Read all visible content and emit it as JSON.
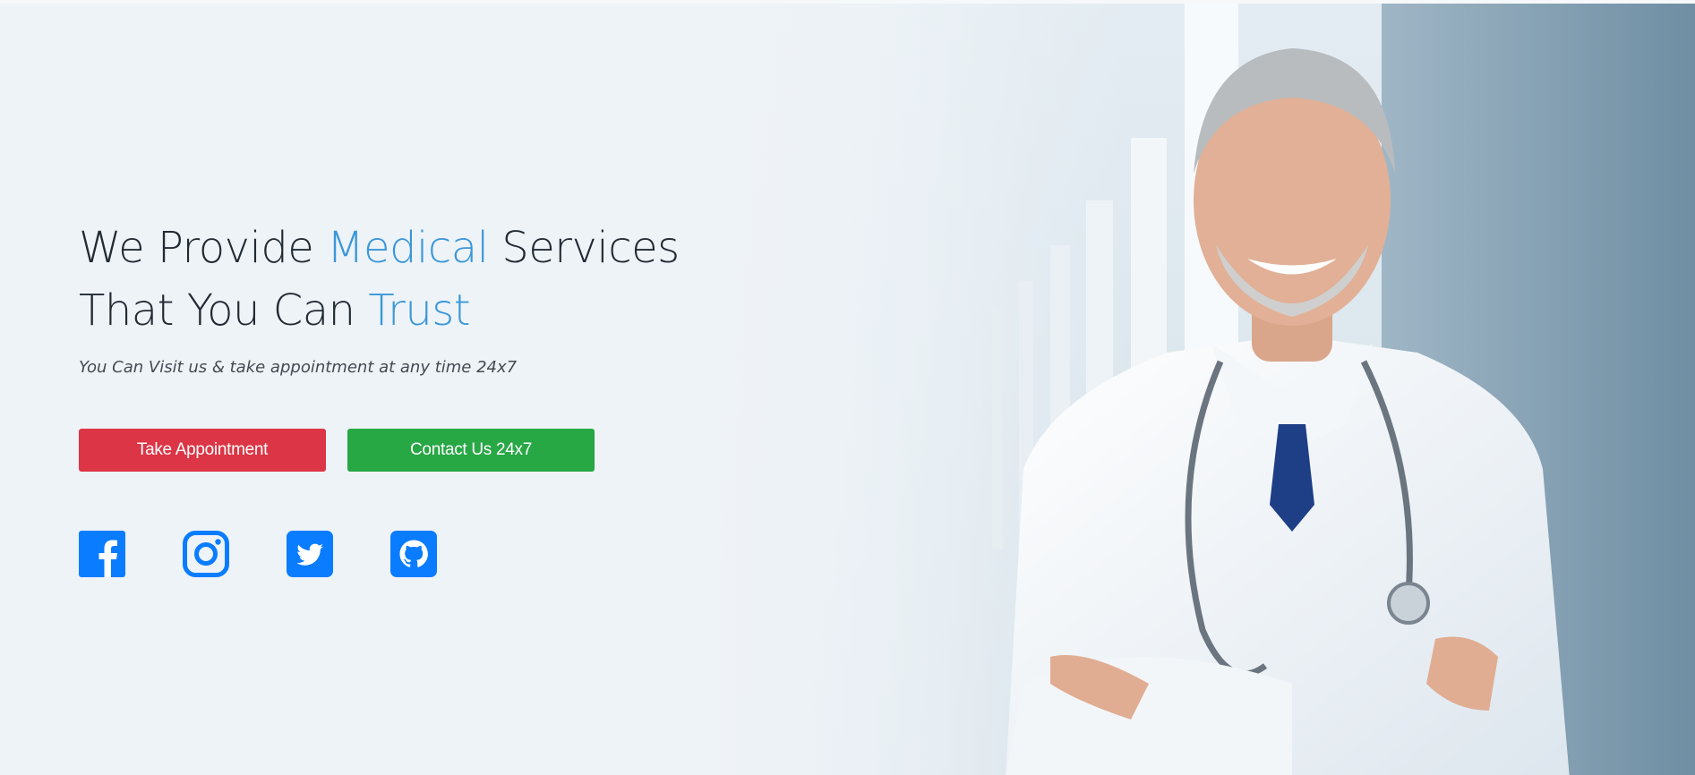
{
  "hero": {
    "headline": {
      "line1_prefix": "We Provide ",
      "line1_accent": "Medical",
      "line1_suffix": " Services",
      "line2_prefix": "That You Can ",
      "line2_accent": "Trust"
    },
    "subtitle": "You Can Visit us & take appointment at any time 24x7",
    "buttons": {
      "appointment": "Take Appointment",
      "contact": "Contact Us 24x7"
    },
    "social": [
      {
        "name": "facebook-icon"
      },
      {
        "name": "instagram-icon"
      },
      {
        "name": "twitter-icon"
      },
      {
        "name": "github-icon"
      }
    ]
  },
  "colors": {
    "accent": "#3b97d8",
    "headline": "#222a33",
    "appointment_button": "#dc3545",
    "contact_button": "#28a745",
    "social": "#0a7cff",
    "background": "#eef3f7"
  }
}
